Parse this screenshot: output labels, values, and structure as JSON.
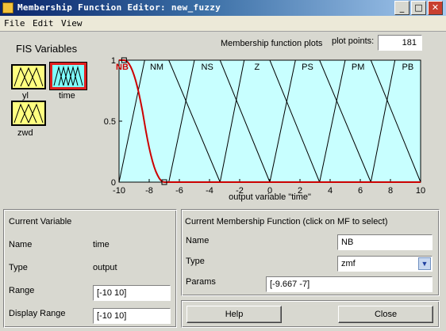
{
  "window": {
    "title": "Membership Function Editor: new_fuzzy",
    "minimize": "_",
    "maximize": "□",
    "close": "✕"
  },
  "menu": [
    "File",
    "Edit",
    "View"
  ],
  "fis_variables": {
    "heading": "FIS Variables",
    "items": [
      {
        "label": "yl",
        "selected": false
      },
      {
        "label": "time",
        "selected": true
      },
      {
        "label": "zwd",
        "selected": false
      }
    ]
  },
  "plot_header": {
    "title": "Membership function plots",
    "plot_points_label": "plot points:",
    "plot_points_value": "181"
  },
  "chart_data": {
    "type": "line",
    "xlabel": "output variable \"time\"",
    "xlim": [
      -10,
      10
    ],
    "ylim": [
      0,
      1
    ],
    "x_ticks": [
      "-10",
      "-8",
      "-6",
      "-4",
      "-2",
      "0",
      "2",
      "4",
      "6",
      "8",
      "10"
    ],
    "y_ticks": [
      "0",
      "0.5",
      "1"
    ],
    "background": "#c8ffff",
    "series": [
      {
        "name": "NB",
        "shape": "zmf",
        "params": [
          -9.667,
          -7
        ],
        "selected": true,
        "color": "#cc0000"
      },
      {
        "name": "NM",
        "shape": "trimf",
        "points": [
          [
            -10,
            0
          ],
          [
            -8.3,
            1
          ],
          [
            -6.7,
            1
          ],
          [
            -3.3,
            0
          ]
        ]
      },
      {
        "name": "NS",
        "shape": "trapmf",
        "points": [
          [
            -6.7,
            0
          ],
          [
            -5,
            1
          ],
          [
            -3.3,
            1
          ],
          [
            0,
            0
          ]
        ]
      },
      {
        "name": "Z",
        "shape": "trapmf",
        "points": [
          [
            -3.3,
            0
          ],
          [
            -1.7,
            1
          ],
          [
            0,
            1
          ],
          [
            3.3,
            0
          ]
        ]
      },
      {
        "name": "PS",
        "shape": "trapmf",
        "points": [
          [
            0,
            0
          ],
          [
            1.7,
            1
          ],
          [
            3.3,
            1
          ],
          [
            6.7,
            0
          ]
        ]
      },
      {
        "name": "PM",
        "shape": "trapmf",
        "points": [
          [
            3.3,
            0
          ],
          [
            5,
            1
          ],
          [
            6.7,
            1
          ],
          [
            10,
            0
          ]
        ]
      },
      {
        "name": "PB",
        "shape": "trapmf",
        "points": [
          [
            6.7,
            0
          ],
          [
            8.3,
            1
          ],
          [
            10,
            1
          ],
          [
            10,
            1
          ]
        ]
      }
    ],
    "curve_color": "#000000"
  },
  "current_variable": {
    "heading": "Current Variable",
    "name_label": "Name",
    "name_value": "time",
    "type_label": "Type",
    "type_value": "output",
    "range_label": "Range",
    "range_value": "[-10 10]",
    "display_range_label": "Display Range",
    "display_range_value": "[-10 10]"
  },
  "current_mf": {
    "heading": "Current Membership Function (click on MF to select)",
    "name_label": "Name",
    "name_value": "NB",
    "type_label": "Type",
    "type_value": "zmf",
    "params_label": "Params",
    "params_value": "[-9.667 -7]"
  },
  "buttons": {
    "help": "Help",
    "close": "Close"
  }
}
